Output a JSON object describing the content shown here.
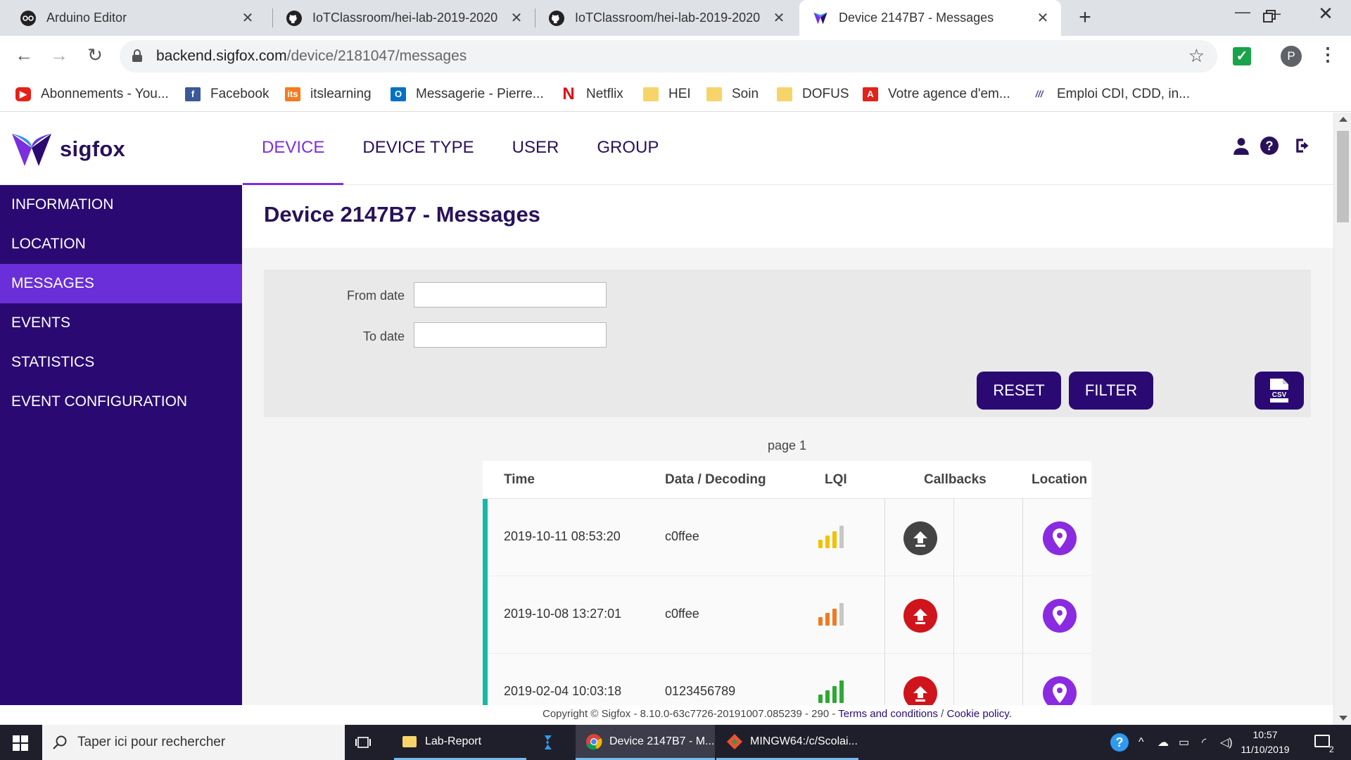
{
  "browser": {
    "tabs": [
      {
        "title": "Arduino Editor",
        "icon": "arduino-icon"
      },
      {
        "title": "IoTClassroom/hei-lab-2019-2020",
        "icon": "github-icon"
      },
      {
        "title": "IoTClassroom/hei-lab-2019-2020",
        "icon": "github-icon"
      },
      {
        "title": "Device 2147B7 - Messages",
        "icon": "sigfox-icon",
        "active": true
      }
    ],
    "url": {
      "domain": "backend.sigfox.com",
      "path": "/device/2181047/messages"
    },
    "profile_initial": "P",
    "bookmarks": [
      {
        "label": "Abonnements - You...",
        "icon": "youtube-icon"
      },
      {
        "label": "Facebook",
        "icon": "facebook-icon"
      },
      {
        "label": "itslearning",
        "icon": "itslearning-icon"
      },
      {
        "label": "Messagerie - Pierre...",
        "icon": "outlook-icon"
      },
      {
        "label": "Netflix",
        "icon": "netflix-icon"
      },
      {
        "label": "HEI",
        "icon": "folder-icon"
      },
      {
        "label": "Soin",
        "icon": "folder-icon"
      },
      {
        "label": "DOFUS",
        "icon": "folder-icon"
      },
      {
        "label": "Votre agence d'em...",
        "icon": "adecco-icon"
      },
      {
        "label": "Emploi CDI, CDD, in...",
        "icon": "jobs-icon"
      }
    ]
  },
  "site": {
    "logo_text": "sigfox",
    "nav": [
      {
        "label": "DEVICE",
        "active": true
      },
      {
        "label": "DEVICE TYPE"
      },
      {
        "label": "USER"
      },
      {
        "label": "GROUP"
      }
    ],
    "sidebar": [
      {
        "label": "INFORMATION"
      },
      {
        "label": "LOCATION"
      },
      {
        "label": "MESSAGES",
        "active": true
      },
      {
        "label": "EVENTS"
      },
      {
        "label": "STATISTICS"
      },
      {
        "label": "EVENT CONFIGURATION"
      }
    ],
    "title": "Device 2147B7 - Messages",
    "filter": {
      "from_label": "From date",
      "from_value": "",
      "to_label": "To date",
      "to_value": "",
      "reset_label": "RESET",
      "filter_label": "FILTER",
      "csv_label": "CSV"
    },
    "page_label": "page 1",
    "table": {
      "headers": [
        "Time",
        "Data / Decoding",
        "LQI",
        "Callbacks",
        "Location"
      ],
      "rows": [
        {
          "time": "2019-10-11 08:53:20",
          "data": "c0ffee",
          "lqi_level": 3,
          "lqi_color": "#f2c200",
          "callback_status": "ok",
          "callback_color": "#444444"
        },
        {
          "time": "2019-10-08 13:27:01",
          "data": "c0ffee",
          "lqi_level": 3,
          "lqi_color": "#f07a22",
          "callback_status": "error",
          "callback_color": "#d0141b"
        },
        {
          "time": "2019-02-04 10:03:18",
          "data": "0123456789",
          "lqi_level": 4,
          "lqi_color": "#2fa834",
          "callback_status": "error",
          "callback_color": "#d0141b"
        }
      ]
    },
    "footer": {
      "copyright": "Copyright © Sigfox - 8.10.0-63c7726-20191007.085239 - 290 - ",
      "terms": "Terms and conditions",
      "sep": " / ",
      "cookie": "Cookie policy."
    },
    "colors": {
      "primary": "#2a0a72",
      "accent": "#7b2fe0",
      "row_accent": "#16b9a7"
    }
  },
  "taskbar": {
    "search_placeholder": "Taper ici pour rechercher",
    "items": [
      {
        "label": "Lab-Report",
        "icon": "folder-icon"
      },
      {
        "label": "",
        "icon": "vscode-icon"
      },
      {
        "label": "Device 2147B7 - M...",
        "icon": "chrome-icon",
        "active": true
      },
      {
        "label": "MINGW64:/c/Scolai...",
        "icon": "git-bash-icon"
      }
    ],
    "time": "10:57",
    "date": "11/10/2019",
    "notifications": "2"
  }
}
